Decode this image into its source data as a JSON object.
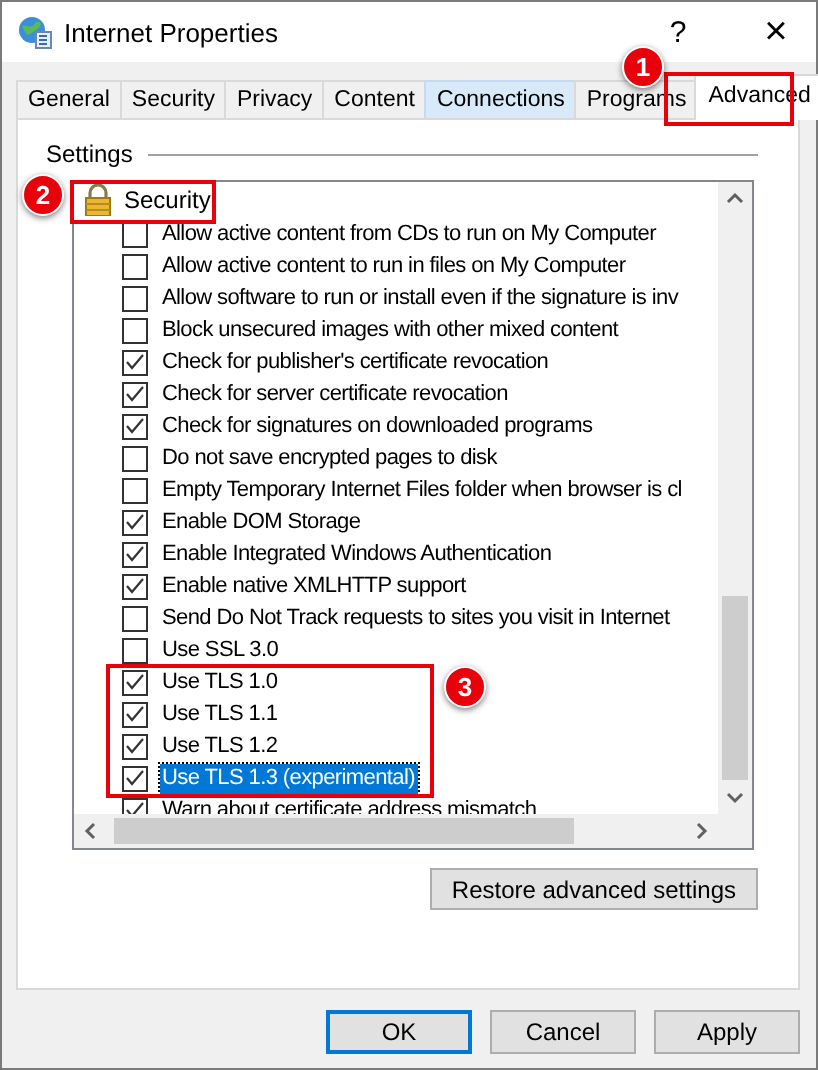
{
  "window": {
    "title": "Internet Properties",
    "help": "?",
    "close": "×"
  },
  "tabs": [
    {
      "label": "General",
      "selected": false,
      "hover": false
    },
    {
      "label": "Security",
      "selected": false,
      "hover": false
    },
    {
      "label": "Privacy",
      "selected": false,
      "hover": false
    },
    {
      "label": "Content",
      "selected": false,
      "hover": false
    },
    {
      "label": "Connections",
      "selected": false,
      "hover": true
    },
    {
      "label": "Programs",
      "selected": false,
      "hover": false
    },
    {
      "label": "Advanced",
      "selected": true,
      "hover": false
    }
  ],
  "settings": {
    "legend": "Settings",
    "group": "Security",
    "options": [
      {
        "label": "Allow active content from CDs to run on My Computer",
        "checked": false,
        "selected": false
      },
      {
        "label": "Allow active content to run in files on My Computer",
        "checked": false,
        "selected": false
      },
      {
        "label": "Allow software to run or install even if the signature is inv",
        "checked": false,
        "selected": false
      },
      {
        "label": "Block unsecured images with other mixed content",
        "checked": false,
        "selected": false
      },
      {
        "label": "Check for publisher's certificate revocation",
        "checked": true,
        "selected": false
      },
      {
        "label": "Check for server certificate revocation",
        "checked": true,
        "selected": false
      },
      {
        "label": "Check for signatures on downloaded programs",
        "checked": true,
        "selected": false
      },
      {
        "label": "Do not save encrypted pages to disk",
        "checked": false,
        "selected": false
      },
      {
        "label": "Empty Temporary Internet Files folder when browser is cl",
        "checked": false,
        "selected": false
      },
      {
        "label": "Enable DOM Storage",
        "checked": true,
        "selected": false
      },
      {
        "label": "Enable Integrated Windows Authentication",
        "checked": true,
        "selected": false
      },
      {
        "label": "Enable native XMLHTTP support",
        "checked": true,
        "selected": false
      },
      {
        "label": "Send Do Not Track requests to sites you visit in Internet",
        "checked": false,
        "selected": false
      },
      {
        "label": "Use SSL 3.0",
        "checked": false,
        "selected": false
      },
      {
        "label": "Use TLS 1.0",
        "checked": true,
        "selected": false
      },
      {
        "label": "Use TLS 1.1",
        "checked": true,
        "selected": false
      },
      {
        "label": "Use TLS 1.2",
        "checked": true,
        "selected": false
      },
      {
        "label": "Use TLS 1.3 (experimental)",
        "checked": true,
        "selected": true
      },
      {
        "label": "Warn about certificate address mismatch",
        "checked": true,
        "selected": false
      }
    ]
  },
  "restore_button": "Restore advanced settings",
  "buttons": [
    {
      "label": "OK",
      "default": true
    },
    {
      "label": "Cancel",
      "default": false
    },
    {
      "label": "Apply",
      "default": false
    }
  ],
  "callouts": [
    "1",
    "2",
    "3"
  ]
}
